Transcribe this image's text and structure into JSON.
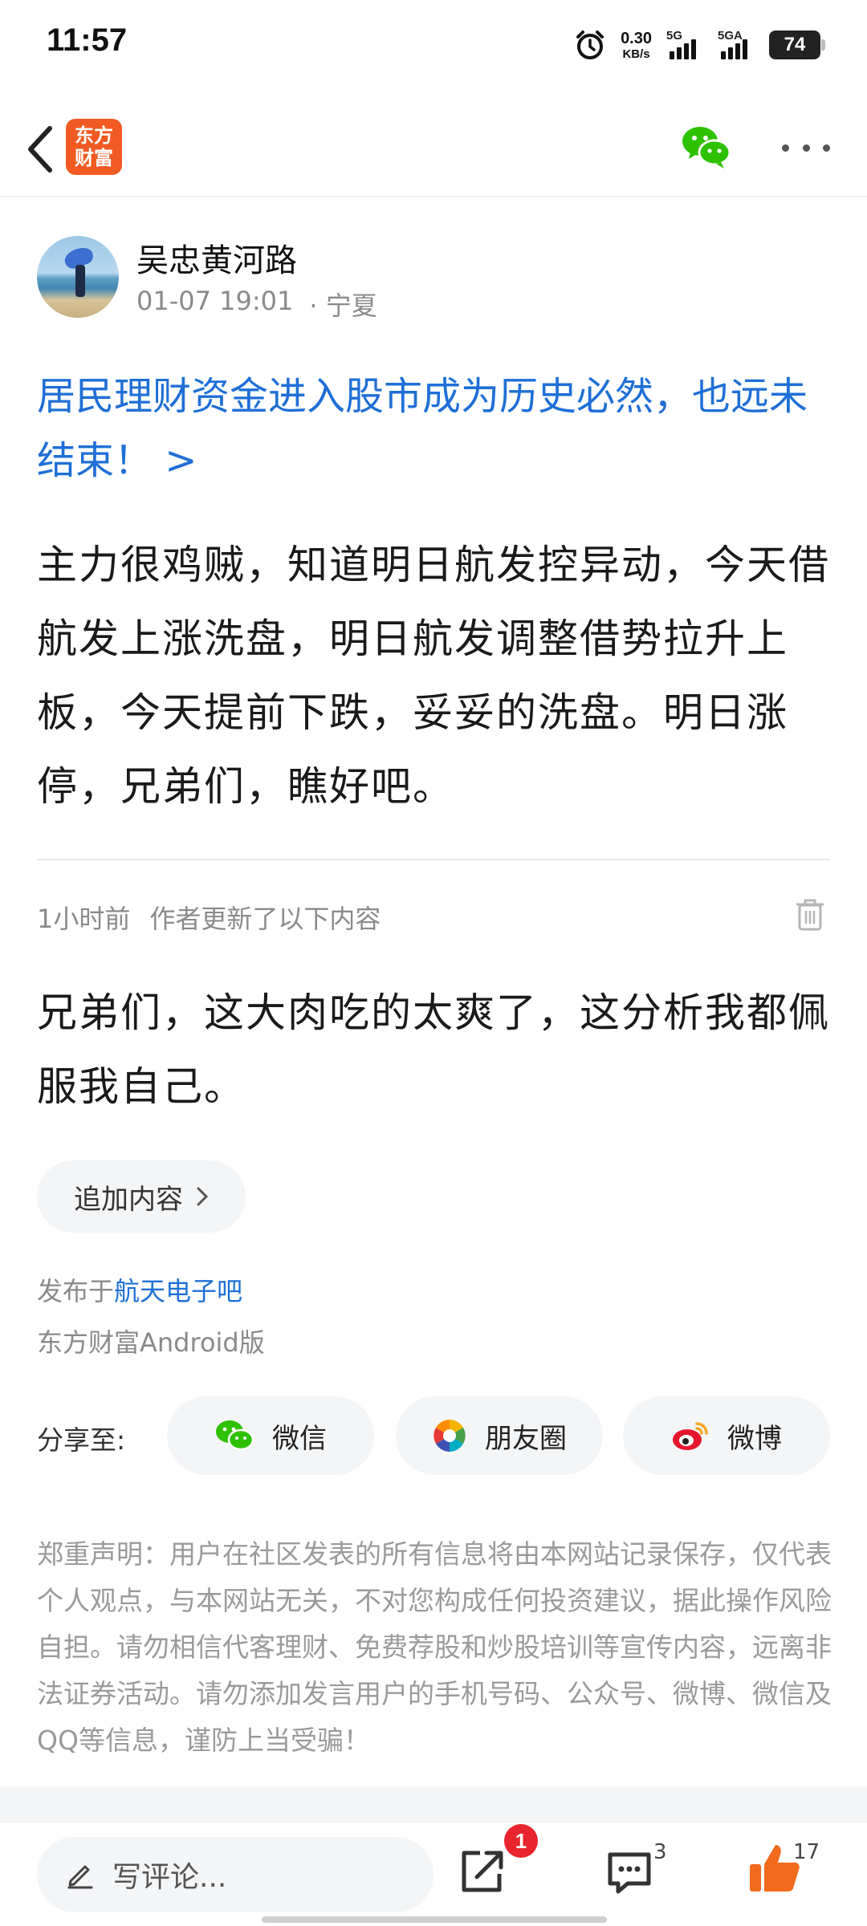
{
  "status_bar": {
    "time": "11:57",
    "net_speed_value": "0.30",
    "net_speed_unit": "KB/s",
    "signal1_label": "5G",
    "signal2_label": "5GA",
    "battery": "74"
  },
  "nav": {
    "app_logo_line1": "东方",
    "app_logo_line2": "财富",
    "icons": [
      "back-arrow-icon",
      "wechat-icon",
      "more-icon"
    ]
  },
  "post": {
    "author": "吴忠黄河路",
    "datetime": "01-07 19:01",
    "location": "· 宁夏",
    "title": "居民理财资金进入股市成为历史必然，也远未结束！ >",
    "body": "主力很鸡贼，知道明日航发控异动，今天借航发上涨洗盘，明日航发调整借势拉升上板，今天提前下跌，妥妥的洗盘。明日涨停，兄弟们，瞧好吧。",
    "update_time": "1小时前",
    "update_label": "作者更新了以下内容",
    "update_body": "兄弟们，这大肉吃的太爽了，这分析我都佩服我自己。",
    "append_label": "追加内容",
    "published_prefix": "发布于",
    "forum": "航天电子吧",
    "client": "东方财富Android版"
  },
  "share": {
    "label": "分享至:",
    "wechat": "微信",
    "moments": "朋友圈",
    "weibo": "微博"
  },
  "disclaimer": "郑重声明：用户在社区发表的所有信息将由本网站记录保存，仅代表个人观点，与本网站无关，不对您构成任何投资建议，据此操作风险自担。请勿相信代客理财、免费荐股和炒股培训等宣传内容，远离非法证券活动。请勿添加发言用户的手机号码、公众号、微博、微信及QQ等信息，谨防上当受骗！",
  "bottom_bar": {
    "comment_placeholder": "写评论...",
    "share_badge": "1",
    "comment_count": "3",
    "like_count": "17"
  },
  "colors": {
    "link": "#1e6fd6",
    "brand": "#f15a22",
    "like": "#f26a1b",
    "badge": "#e8242c",
    "wechat_green": "#2dc100"
  }
}
